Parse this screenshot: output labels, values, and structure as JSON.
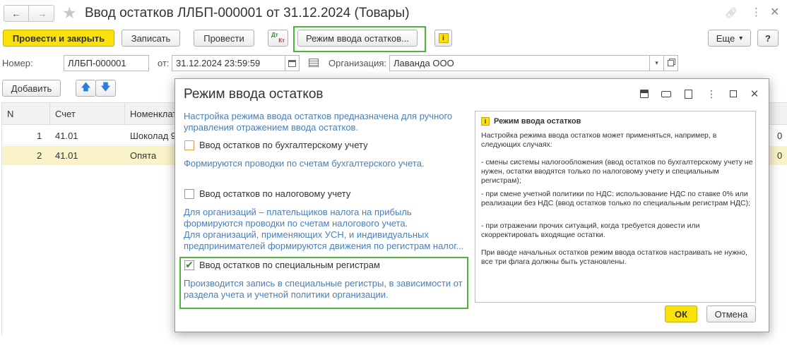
{
  "window": {
    "title": "Ввод остатков ЛЛБП-000001 от 31.12.2024 (Товары)"
  },
  "toolbar": {
    "post_close": "Провести и закрыть",
    "save": "Записать",
    "post": "Провести",
    "dtkt_top": "Дт",
    "dtkt_bottom": "Кт",
    "balance_mode": "Режим ввода остатков...",
    "more": "Еще",
    "more_arrow": "▾",
    "help": "?"
  },
  "header_fields": {
    "number_label": "Номер:",
    "number_value": "ЛЛБП-000001",
    "date_label": "от:",
    "date_value": "31.12.2024 23:59:59",
    "org_label": "Организация:",
    "org_value": "Лаванда ООО"
  },
  "grid_toolbar": {
    "add": "Добавить"
  },
  "grid": {
    "columns": [
      "N",
      "Счет",
      "Номенклату"
    ],
    "rows": [
      {
        "n": "1",
        "account": "41.01",
        "item": "Шоколад 9"
      },
      {
        "n": "2",
        "account": "41.01",
        "item": "Опята"
      }
    ],
    "right_fragment": "0"
  },
  "dialog": {
    "title": "Режим ввода остатков",
    "intro": "Настройка режима ввода остатков предназначена для ручного управления отражением  ввода остатков.",
    "options": [
      {
        "label": "Ввод остатков по бухгалтерскому учету",
        "checked": false,
        "desc": "Формируются проводки по счетам бухгалтерского учета."
      },
      {
        "label": "Ввод остатков по налоговому учету",
        "checked": false,
        "desc_line1": "Для организаций – плательщиков налога на прибыль",
        "desc_line2": "формируются проводки по счетам налогового учета.",
        "desc_line3": "Для организаций, применяющих УСН, и  индивидуальных",
        "desc_line4": "предпринимателей формируются движения по регистрам налог..."
      },
      {
        "label": "Ввод остатков по специальным регистрам",
        "checked": true,
        "desc": "Производится запись в специальные регистры, в зависимости от раздела учета и учетной политики организации."
      }
    ],
    "info": {
      "title": "Режим ввода остатков",
      "p1": "Настройка режима ввода остатков может применяться, например, в следующих случаях:",
      "p2": "- смены системы налогообложения (ввод остатков по бухгалтерскому учету не нужен, остатки вводятся только по налоговому учету и специальным регистрам);",
      "p3": "- при смене учетной политики по НДС: использование НДС по ставке 0% или реализации без НДС (ввод остатков только по специальным регистрам НДС);",
      "p4": "- при отражении прочих ситуаций, когда требуется довести или скорректировать входящие остатки.",
      "p5": "При вводе начальных остатков режим ввода остатков настраивать не нужно, все три флага должны быть установлены."
    },
    "ok": "ОК",
    "cancel": "Отмена"
  },
  "colors": {
    "accent_yellow": "#fbe10a",
    "highlight_green": "#4db53a",
    "link_blue": "#4a7fb8",
    "selected_row": "#fbf3c8"
  }
}
